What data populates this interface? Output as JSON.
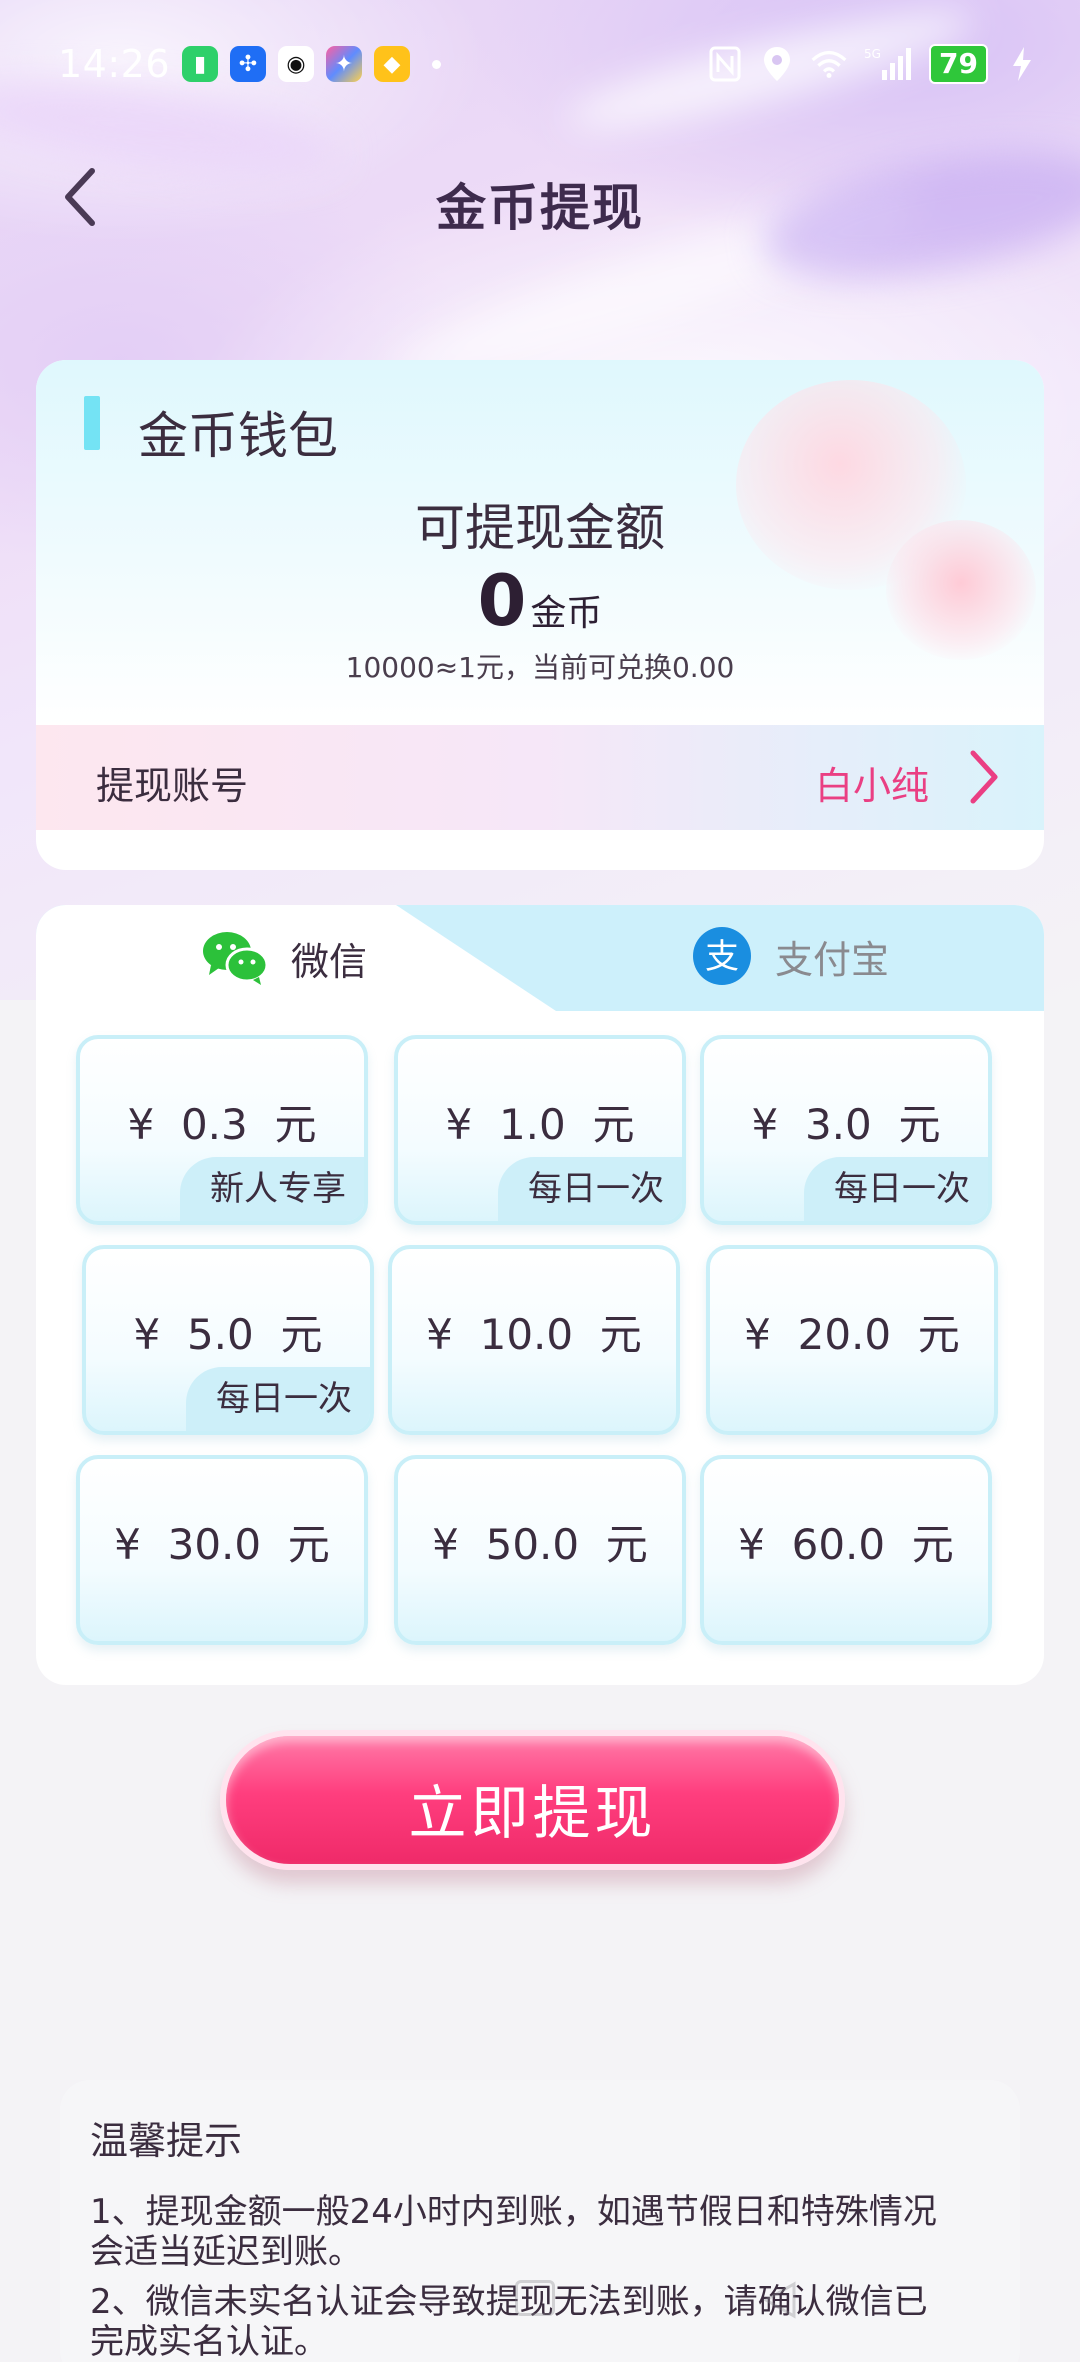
{
  "status_bar": {
    "time": "14:26",
    "battery": "79",
    "network": "5G"
  },
  "nav": {
    "title": "金币提现"
  },
  "wallet": {
    "title": "金币钱包",
    "available_label": "可提现金额",
    "coins": "0",
    "coin_unit": "金币",
    "rate_text": "10000≈1元，当前可兑换0.00",
    "account_label": "提现账号",
    "account_value": "白小纯"
  },
  "payment_tabs": [
    {
      "label": "微信",
      "selected": true,
      "icon": "wechat-icon"
    },
    {
      "label": "支付宝",
      "selected": false,
      "icon": "alipay-icon"
    }
  ],
  "amounts": [
    {
      "text": "¥  0.3  元",
      "tag": "新人专享"
    },
    {
      "text": "¥  1.0  元",
      "tag": "每日一次"
    },
    {
      "text": "¥  3.0  元",
      "tag": "每日一次"
    },
    {
      "text": "¥  5.0  元",
      "tag": "每日一次"
    },
    {
      "text": "¥  10.0  元",
      "tag": ""
    },
    {
      "text": "¥  20.0  元",
      "tag": ""
    },
    {
      "text": "¥  30.0  元",
      "tag": ""
    },
    {
      "text": "¥  50.0  元",
      "tag": ""
    },
    {
      "text": "¥  60.0  元",
      "tag": ""
    }
  ],
  "submit_label": "立即提现",
  "tips": {
    "title": "温馨提示",
    "lines": [
      "1、提现金额一般24小时内到账，如遇节假日和特殊情况",
      "会适当延迟到账。",
      "2、微信未实名认证会导致提现无法到账，请确认微信已",
      "完成实名认证。"
    ]
  },
  "colors": {
    "accent_pink": "#ea3f83",
    "button_pink": "#ff3e7e",
    "wallet_bar": "#74e3f4",
    "tab_inactive_bg": "#cdf0fb",
    "wechat_green": "#2cc13a",
    "alipay_blue": "#1a8ee0"
  }
}
